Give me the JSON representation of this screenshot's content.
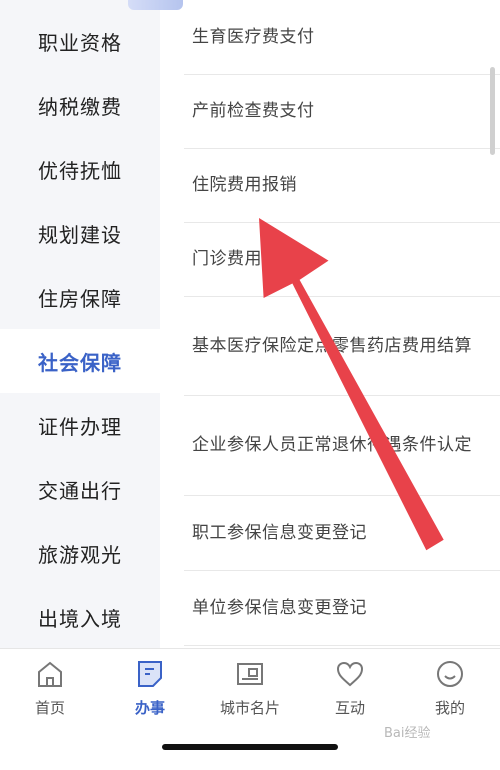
{
  "categories": [
    {
      "label": "职业资格",
      "active": false
    },
    {
      "label": "纳税缴费",
      "active": false
    },
    {
      "label": "优待抚恤",
      "active": false
    },
    {
      "label": "规划建设",
      "active": false
    },
    {
      "label": "住房保障",
      "active": false
    },
    {
      "label": "社会保障",
      "active": true
    },
    {
      "label": "证件办理",
      "active": false
    },
    {
      "label": "交通出行",
      "active": false
    },
    {
      "label": "旅游观光",
      "active": false
    },
    {
      "label": "出境入境",
      "active": false
    }
  ],
  "services": [
    "生育医疗费支付",
    "产前检查费支付",
    "住院费用报销",
    "门诊费用",
    "基本医疗保险定点零售药店费用结算",
    "企业参保人员正常退休待遇条件认定",
    "职工参保信息变更登记",
    "单位参保信息变更登记"
  ],
  "tabbar": [
    {
      "label": "首页",
      "icon": "home-icon",
      "active": false
    },
    {
      "label": "办事",
      "icon": "task-icon",
      "active": true
    },
    {
      "label": "城市名片",
      "icon": "card-icon",
      "active": false
    },
    {
      "label": "互动",
      "icon": "heart-icon",
      "active": false
    },
    {
      "label": "我的",
      "icon": "smile-icon",
      "active": false
    }
  ],
  "colors": {
    "accent": "#3a62c7",
    "arrow": "#e8424a"
  },
  "watermark": "Bai经验"
}
